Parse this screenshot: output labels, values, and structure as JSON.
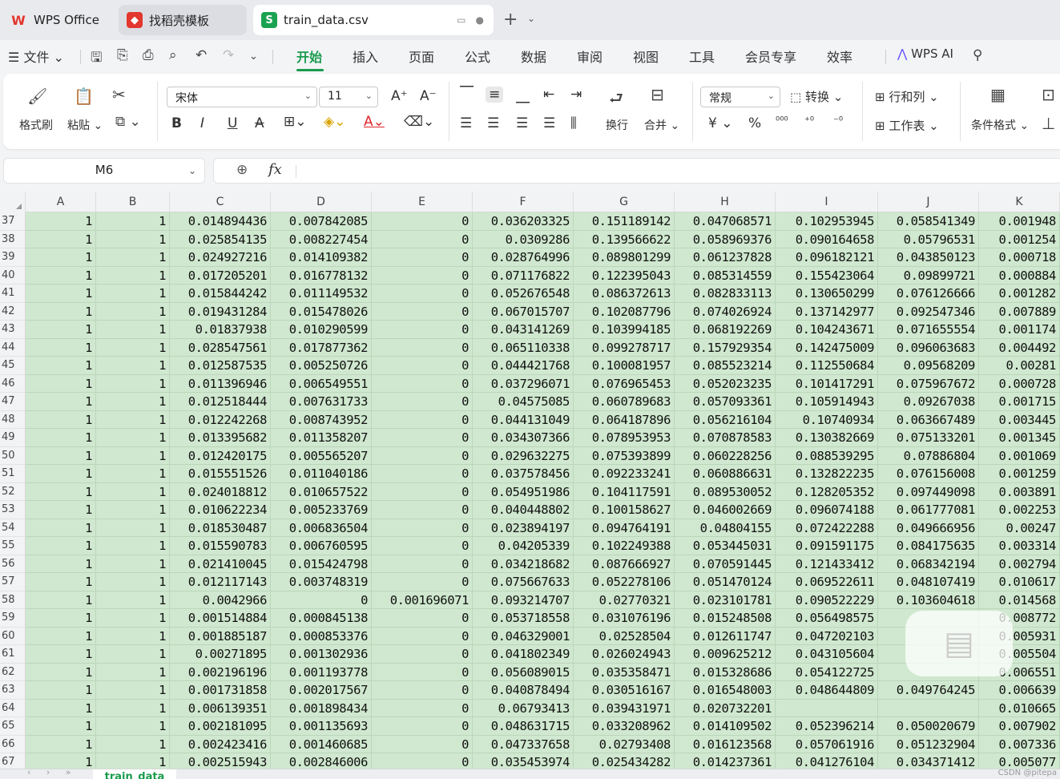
{
  "tabs": [
    {
      "label": "WPS Office"
    },
    {
      "label": "找稻壳模板"
    },
    {
      "label": "train_data.csv"
    }
  ],
  "menu": {
    "file": "文件",
    "items": [
      "开始",
      "插入",
      "页面",
      "公式",
      "数据",
      "审阅",
      "视图",
      "工具",
      "会员专享",
      "效率"
    ],
    "active": "开始",
    "ai": "WPS AI"
  },
  "ribbon": {
    "format_painter": "格式刷",
    "paste": "粘贴",
    "font_name": "宋体",
    "font_size": "11",
    "wrap": "换行",
    "merge": "合并",
    "number_format": "常规",
    "convert": "转换",
    "rowcol": "行和列",
    "worksheet": "工作表",
    "cond_format": "条件格式",
    "currency_symbol": "¥",
    "percent_symbol": "%"
  },
  "formula_bar": {
    "cell_ref": "M6",
    "fx": "fx",
    "value": ""
  },
  "columns": [
    "A",
    "B",
    "C",
    "D",
    "E",
    "F",
    "G",
    "H",
    "I",
    "J",
    "K"
  ],
  "rows": [
    {
      "n": "37",
      "v": [
        "1",
        "1",
        "0.014894436",
        "0.007842085",
        "0",
        "0.036203325",
        "0.151189142",
        "0.047068571",
        "0.102953945",
        "0.058541349",
        "0.001948"
      ]
    },
    {
      "n": "38",
      "v": [
        "1",
        "1",
        "0.025854135",
        "0.008227454",
        "0",
        "0.0309286",
        "0.139566622",
        "0.058969376",
        "0.090164658",
        "0.05796531",
        "0.001254"
      ]
    },
    {
      "n": "39",
      "v": [
        "1",
        "1",
        "0.024927216",
        "0.014109382",
        "0",
        "0.028764996",
        "0.089801299",
        "0.061237828",
        "0.096182121",
        "0.043850123",
        "0.000718"
      ]
    },
    {
      "n": "40",
      "v": [
        "1",
        "1",
        "0.017205201",
        "0.016778132",
        "0",
        "0.071176822",
        "0.122395043",
        "0.085314559",
        "0.155423064",
        "0.09899721",
        "0.000884"
      ]
    },
    {
      "n": "41",
      "v": [
        "1",
        "1",
        "0.015844242",
        "0.011149532",
        "0",
        "0.052676548",
        "0.086372613",
        "0.082833113",
        "0.130650299",
        "0.076126666",
        "0.001282"
      ]
    },
    {
      "n": "42",
      "v": [
        "1",
        "1",
        "0.019431284",
        "0.015478026",
        "0",
        "0.067015707",
        "0.102087796",
        "0.074026924",
        "0.137142977",
        "0.092547346",
        "0.007889"
      ]
    },
    {
      "n": "43",
      "v": [
        "1",
        "1",
        "0.01837938",
        "0.010290599",
        "0",
        "0.043141269",
        "0.103994185",
        "0.068192269",
        "0.104243671",
        "0.071655554",
        "0.001174"
      ]
    },
    {
      "n": "44",
      "v": [
        "1",
        "1",
        "0.028547561",
        "0.017877362",
        "0",
        "0.065110338",
        "0.099278717",
        "0.157929354",
        "0.142475009",
        "0.096063683",
        "0.004492"
      ]
    },
    {
      "n": "45",
      "v": [
        "1",
        "1",
        "0.012587535",
        "0.005250726",
        "0",
        "0.044421768",
        "0.100081957",
        "0.085523214",
        "0.112550684",
        "0.09568209",
        "0.00281"
      ]
    },
    {
      "n": "46",
      "v": [
        "1",
        "1",
        "0.011396946",
        "0.006549551",
        "0",
        "0.037296071",
        "0.076965453",
        "0.052023235",
        "0.101417291",
        "0.075967672",
        "0.000728"
      ]
    },
    {
      "n": "47",
      "v": [
        "1",
        "1",
        "0.012518444",
        "0.007631733",
        "0",
        "0.04575085",
        "0.060789683",
        "0.057093361",
        "0.105914943",
        "0.09267038",
        "0.001715"
      ]
    },
    {
      "n": "48",
      "v": [
        "1",
        "1",
        "0.012242268",
        "0.008743952",
        "0",
        "0.044131049",
        "0.064187896",
        "0.056216104",
        "0.10740934",
        "0.063667489",
        "0.003445"
      ]
    },
    {
      "n": "49",
      "v": [
        "1",
        "1",
        "0.013395682",
        "0.011358207",
        "0",
        "0.034307366",
        "0.078953953",
        "0.070878583",
        "0.130382669",
        "0.075133201",
        "0.001345"
      ]
    },
    {
      "n": "50",
      "v": [
        "1",
        "1",
        "0.012420175",
        "0.005565207",
        "0",
        "0.029632275",
        "0.075393899",
        "0.060228256",
        "0.088539295",
        "0.07886804",
        "0.001069"
      ]
    },
    {
      "n": "51",
      "v": [
        "1",
        "1",
        "0.015551526",
        "0.011040186",
        "0",
        "0.037578456",
        "0.092233241",
        "0.060886631",
        "0.132822235",
        "0.076156008",
        "0.001259"
      ]
    },
    {
      "n": "52",
      "v": [
        "1",
        "1",
        "0.024018812",
        "0.010657522",
        "0",
        "0.054951986",
        "0.104117591",
        "0.089530052",
        "0.128205352",
        "0.097449098",
        "0.003891"
      ]
    },
    {
      "n": "53",
      "v": [
        "1",
        "1",
        "0.010622234",
        "0.005233769",
        "0",
        "0.040448802",
        "0.100158627",
        "0.046002669",
        "0.096074188",
        "0.061777081",
        "0.002253"
      ]
    },
    {
      "n": "54",
      "v": [
        "1",
        "1",
        "0.018530487",
        "0.006836504",
        "0",
        "0.023894197",
        "0.094764191",
        "0.04804155",
        "0.072422288",
        "0.049666956",
        "0.00247"
      ]
    },
    {
      "n": "55",
      "v": [
        "1",
        "1",
        "0.015590783",
        "0.006760595",
        "0",
        "0.04205339",
        "0.102249388",
        "0.053445031",
        "0.091591175",
        "0.084175635",
        "0.003314"
      ]
    },
    {
      "n": "56",
      "v": [
        "1",
        "1",
        "0.021410045",
        "0.015424798",
        "0",
        "0.034218682",
        "0.087666927",
        "0.070591445",
        "0.121433412",
        "0.068342194",
        "0.002794"
      ]
    },
    {
      "n": "57",
      "v": [
        "1",
        "1",
        "0.012117143",
        "0.003748319",
        "0",
        "0.075667633",
        "0.052278106",
        "0.051470124",
        "0.069522611",
        "0.048107419",
        "0.010617"
      ]
    },
    {
      "n": "58",
      "v": [
        "1",
        "1",
        "0.0042966",
        "0",
        "0.001696071",
        "0.093214707",
        "0.02770321",
        "0.023101781",
        "0.090522229",
        "0.103604618",
        "0.014568"
      ]
    },
    {
      "n": "59",
      "v": [
        "1",
        "1",
        "0.001514884",
        "0.000845138",
        "0",
        "0.053718558",
        "0.031076196",
        "0.015248508",
        "0.056498575",
        "",
        "0.008772"
      ]
    },
    {
      "n": "60",
      "v": [
        "1",
        "1",
        "0.001885187",
        "0.000853376",
        "0",
        "0.046329001",
        "0.02528504",
        "0.012611747",
        "0.047202103",
        "",
        "0.005931"
      ]
    },
    {
      "n": "61",
      "v": [
        "1",
        "1",
        "0.00271895",
        "0.001302936",
        "0",
        "0.041802349",
        "0.026024943",
        "0.009625212",
        "0.043105604",
        "",
        "0.005504"
      ]
    },
    {
      "n": "62",
      "v": [
        "1",
        "1",
        "0.002196196",
        "0.001193778",
        "0",
        "0.056089015",
        "0.035358471",
        "0.015328686",
        "0.054122725",
        "",
        "0.006551"
      ]
    },
    {
      "n": "63",
      "v": [
        "1",
        "1",
        "0.001731858",
        "0.002017567",
        "0",
        "0.040878494",
        "0.030516167",
        "0.016548003",
        "0.048644809",
        "0.049764245",
        "0.006639"
      ]
    },
    {
      "n": "64",
      "v": [
        "1",
        "1",
        "0.006139351",
        "0.001898434",
        "0",
        "0.06793413",
        "0.039431971",
        "0.020732201",
        "",
        "",
        "0.010665"
      ]
    },
    {
      "n": "65",
      "v": [
        "1",
        "1",
        "0.002181095",
        "0.001135693",
        "0",
        "0.048631715",
        "0.033208962",
        "0.014109502",
        "0.052396214",
        "0.050020679",
        "0.007902"
      ]
    },
    {
      "n": "66",
      "v": [
        "1",
        "1",
        "0.002423416",
        "0.001460685",
        "0",
        "0.047337658",
        "0.02793408",
        "0.016123568",
        "0.057061916",
        "0.051232904",
        "0.007336"
      ]
    },
    {
      "n": "67",
      "v": [
        "1",
        "1",
        "0.002515943",
        "0.002846006",
        "0",
        "0.035453974",
        "0.025434282",
        "0.014237361",
        "0.041276104",
        "0.034371412",
        "0.005077"
      ]
    }
  ],
  "sheet": {
    "name": "train_data"
  },
  "credit": "CSDN @pitepa"
}
